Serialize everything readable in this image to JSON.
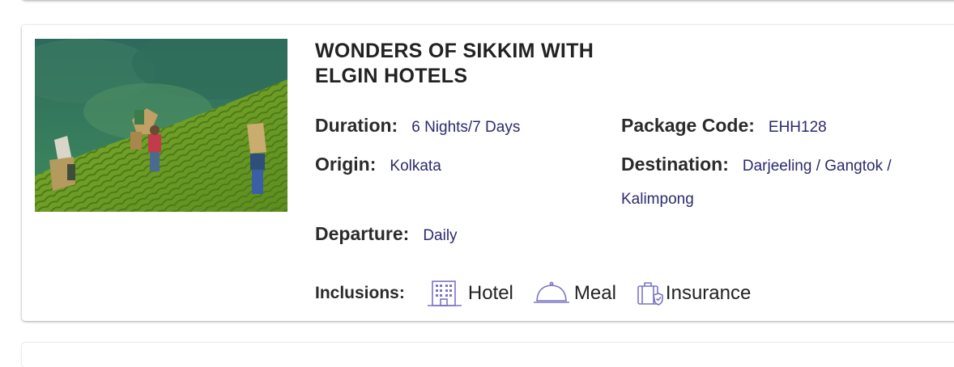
{
  "package": {
    "title": "WONDERS OF SIKKIM WITH ELGIN HOTELS",
    "image": "tea-garden-photo",
    "duration_label": "Duration:",
    "duration_value": "6 Nights/7 Days",
    "code_label": "Package Code:",
    "code_value": "EHH128",
    "origin_label": "Origin:",
    "origin_value": "Kolkata",
    "destination_label": "Destination:",
    "destination_value": "Darjeeling / Gangtok / Kalimpong",
    "departure_label": "Departure:",
    "departure_value": "Daily"
  },
  "inclusions": {
    "label": "Inclusions:",
    "items": [
      {
        "label": "Hotel",
        "icon": "hotel-building-icon"
      },
      {
        "label": "Meal",
        "icon": "meal-cloche-icon"
      },
      {
        "label": "Insurance",
        "icon": "insurance-luggage-icon"
      }
    ]
  },
  "colors": {
    "value_text": "#2c2a6e",
    "icon": "#7b73c4",
    "label_text": "#2b2b2b"
  }
}
